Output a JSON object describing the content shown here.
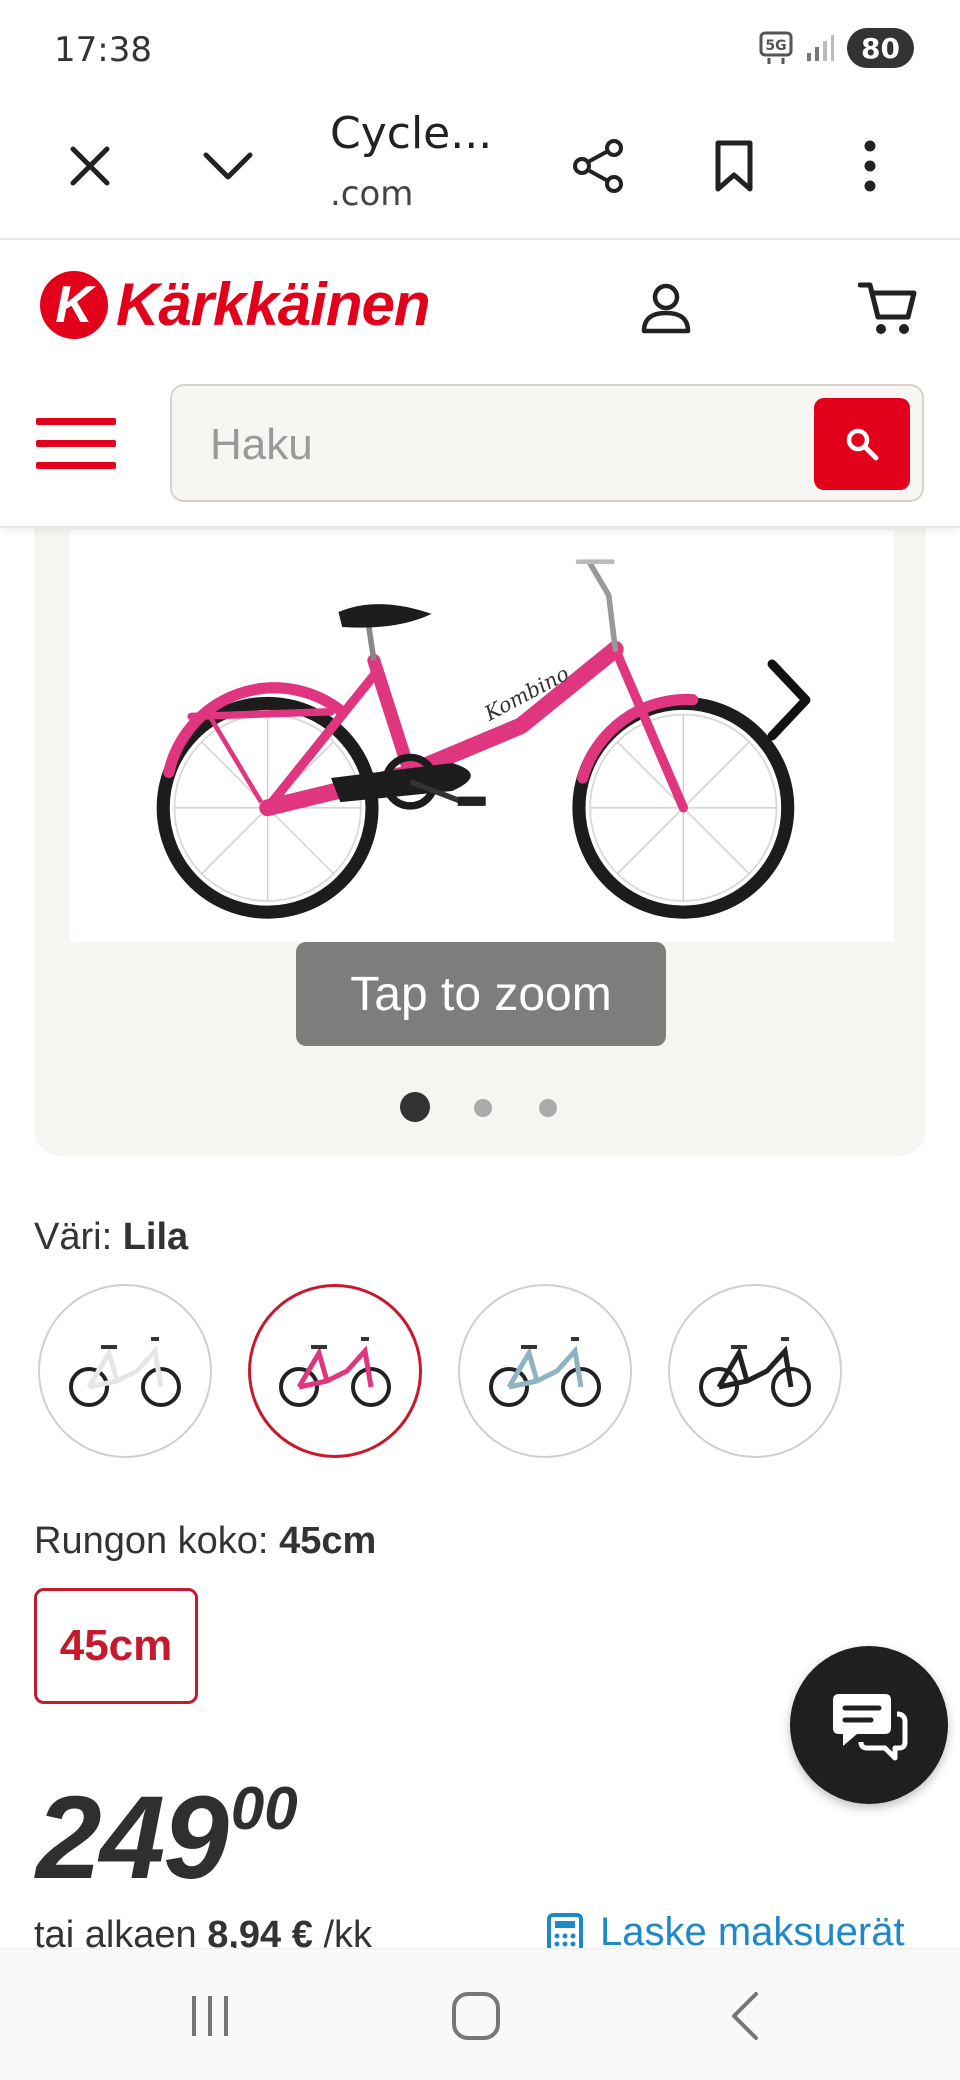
{
  "status_bar": {
    "time": "17:38",
    "battery": "80"
  },
  "browser": {
    "title": "Cycle...",
    "domain": ".com"
  },
  "header": {
    "brand": "Kärkkäinen",
    "search_placeholder": "Haku"
  },
  "gallery": {
    "zoom_label": "Tap to zoom",
    "slides": 3,
    "active_slide": 1
  },
  "options": {
    "color_label": "Väri:",
    "color_value": "Lila",
    "colors": [
      "white",
      "lila",
      "light blue",
      "black"
    ],
    "selected_color": "lila",
    "size_label": "Rungon koko:",
    "size_value": "45cm",
    "sizes": [
      "45cm"
    ]
  },
  "price": {
    "integer": "249",
    "decimals": "00",
    "installment_prefix": "tai alkaen",
    "installment_amount": "8,94 €",
    "installment_suffix": "/kk",
    "calc_label": "Laske maksuerät"
  },
  "colors": {
    "brand_red": "#e2001a",
    "link_blue": "#1e88c8",
    "bike_pink": "#e0357f"
  }
}
